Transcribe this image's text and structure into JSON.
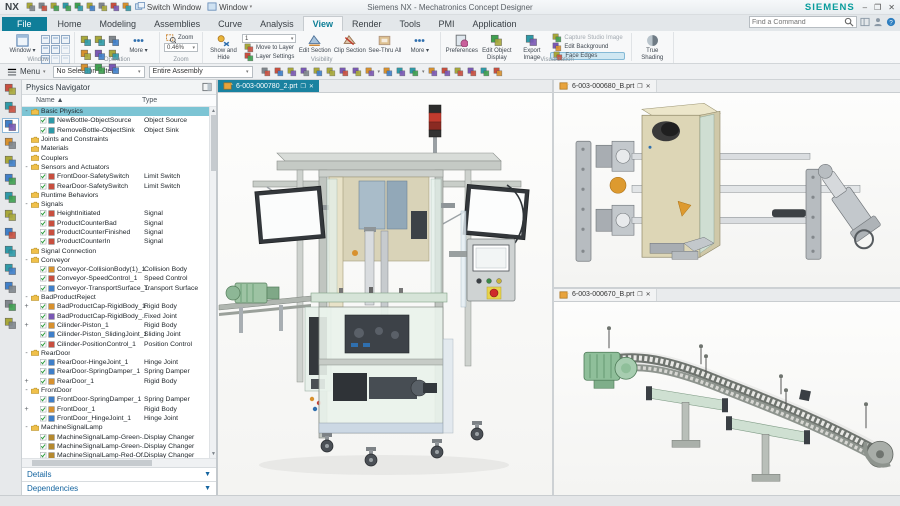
{
  "window": {
    "title": "Siemens NX - Mechatronics Concept Designer",
    "brand": "SIEMENS",
    "switch_window_label": "Switch Window",
    "window_menu_label": "Window",
    "quick_access_icons": [
      "save-icon",
      "undo-icon",
      "redo-icon",
      "cut-icon",
      "copy-icon",
      "paste-icon",
      "touch-mode-icon",
      "sketch-icon",
      "repeat-command-icon"
    ]
  },
  "search": {
    "placeholder": "Find a Command"
  },
  "ribbon": {
    "tabs": [
      {
        "label": "File",
        "kind": "file"
      },
      {
        "label": "Home"
      },
      {
        "label": "Modeling"
      },
      {
        "label": "Assemblies"
      },
      {
        "label": "Curve"
      },
      {
        "label": "Analysis"
      },
      {
        "label": "View",
        "active": true
      },
      {
        "label": "Render"
      },
      {
        "label": "Tools"
      },
      {
        "label": "PMI"
      },
      {
        "label": "Application"
      }
    ],
    "groups": {
      "window": {
        "label": "Window",
        "button": "Window"
      },
      "operation": {
        "label": "Operation",
        "more": "More"
      },
      "zoom": {
        "label": "Zoom",
        "button": "Zoom",
        "value": "0.46%"
      },
      "visibility": {
        "label": "Visibility",
        "show_hide": "Show and Hide",
        "layer_value": "1",
        "move_to_layer": "Move to Layer",
        "layer_settings": "Layer Settings",
        "edit_section": "Edit Section",
        "clip_section": "Clip Section",
        "see_thru": "See-Thru All",
        "more": "More"
      },
      "visualization": {
        "label": "Visualization",
        "preferences": "Preferences",
        "edit_object": "Edit Object Display",
        "export_image": "Export Image",
        "capture": "Capture Studio Image",
        "background": "Edit Background",
        "face_edges": "Face Edges",
        "true_shading": "True Shading"
      }
    }
  },
  "selection_bar": {
    "menu_label": "Menu",
    "filter_value": "No Selection Filter",
    "scope_value": "Entire Assembly",
    "icons": [
      "select-all-icon",
      "snap-point-icon",
      "end-point-icon",
      "mid-point-icon",
      "control-point-icon",
      "intersection-icon",
      "arc-center-icon",
      "quadrant-point-icon",
      "existing-point-icon",
      "point-on-curve-icon",
      "point-on-face-icon",
      "bounded-plane-icon",
      "shaded-icon",
      "wireframe-icon",
      "orient-view-icon",
      "fit-view-icon",
      "pan-icon",
      "rotate-icon"
    ]
  },
  "resource_bar": {
    "icons": [
      "roles-gear-icon",
      "assembly-navigator-icon",
      "physics-navigator-icon",
      "constraint-navigator-icon",
      "part-navigator-icon",
      "reuse-library-icon",
      "hd3d-tools-icon",
      "internet-explorer-icon",
      "history-icon",
      "process-studio-icon",
      "manufacturing-wizard-icon",
      "roles-icon",
      "system-scenes-icon",
      "touch-panel-icon"
    ],
    "active_index": 2
  },
  "navigator": {
    "title": "Physics Navigator",
    "columns": {
      "name": "Name",
      "type": "Type"
    },
    "details_label": "Details",
    "dependencies_label": "Dependencies",
    "items": [
      {
        "name": "Basic Physics",
        "kind": "folder",
        "expand": "-",
        "selected": true,
        "type": ""
      },
      {
        "name": "NewBottle-ObjectSource",
        "kind": "leaf",
        "type": "Object Source"
      },
      {
        "name": "RemoveBottle-ObjectSink",
        "kind": "leaf",
        "type": "Object Sink"
      },
      {
        "name": "Joints and Constraints",
        "kind": "folder",
        "expand": "",
        "type": ""
      },
      {
        "name": "Materials",
        "kind": "folder",
        "expand": "",
        "type": ""
      },
      {
        "name": "Couplers",
        "kind": "folder",
        "expand": "",
        "type": ""
      },
      {
        "name": "Sensors and Actuators",
        "kind": "folder",
        "expand": "-",
        "type": ""
      },
      {
        "name": "FrontDoor-SafetySwitch",
        "kind": "leaf",
        "type": "Limit Switch"
      },
      {
        "name": "RearDoor-SafetySwitch",
        "kind": "leaf",
        "type": "Limit Switch"
      },
      {
        "name": "Runtime Behaviors",
        "kind": "folder",
        "expand": "",
        "type": ""
      },
      {
        "name": "Signals",
        "kind": "folder",
        "expand": "-",
        "type": ""
      },
      {
        "name": "HeightInitiated",
        "kind": "leaf",
        "type": "Signal"
      },
      {
        "name": "ProductCounterBad",
        "kind": "leaf",
        "type": "Signal"
      },
      {
        "name": "ProductCounterFinished",
        "kind": "leaf",
        "type": "Signal"
      },
      {
        "name": "ProductCounterIn",
        "kind": "leaf",
        "type": "Signal"
      },
      {
        "name": "Signal Connection",
        "kind": "folder",
        "expand": "",
        "type": ""
      },
      {
        "name": "Conveyor",
        "kind": "folder",
        "expand": "-",
        "type": ""
      },
      {
        "name": "Conveyor-CollisionBody(1)_1",
        "kind": "leaf",
        "type": "Collision Body"
      },
      {
        "name": "Conveyor-SpeedControl_1",
        "kind": "leaf",
        "type": "Speed Control"
      },
      {
        "name": "Conveyor-TransportSurface_1",
        "kind": "leaf",
        "type": "Transport Surface"
      },
      {
        "name": "BadProductReject",
        "kind": "folder",
        "expand": "-",
        "type": ""
      },
      {
        "name": "BadProductCap-RigidBody_1",
        "kind": "leaf",
        "expand": "+",
        "type": "Rigid Body"
      },
      {
        "name": "BadProductCap-RigidBody_...",
        "kind": "leaf",
        "type": "Fixed Joint"
      },
      {
        "name": "Cilinder-Piston_1",
        "kind": "leaf",
        "expand": "+",
        "type": "Rigid Body"
      },
      {
        "name": "Cilinder-Piston_SlidingJoint_1",
        "kind": "leaf",
        "type": "Sliding Joint"
      },
      {
        "name": "Cilinder-PositionControl_1",
        "kind": "leaf",
        "type": "Position Control"
      },
      {
        "name": "RearDoor",
        "kind": "folder",
        "expand": "-",
        "type": ""
      },
      {
        "name": "RearDoor-HingeJoint_1",
        "kind": "leaf",
        "type": "Hinge Joint"
      },
      {
        "name": "RearDoor-SpringDamper_1",
        "kind": "leaf",
        "type": "Spring Damper"
      },
      {
        "name": "RearDoor_1",
        "kind": "leaf",
        "expand": "+",
        "type": "Rigid Body"
      },
      {
        "name": "FrontDoor",
        "kind": "folder",
        "expand": "-",
        "type": ""
      },
      {
        "name": "FrontDoor-SpringDamper_1",
        "kind": "leaf",
        "type": "Spring Damper"
      },
      {
        "name": "FrontDoor_1",
        "kind": "leaf",
        "expand": "+",
        "type": "Rigid Body"
      },
      {
        "name": "FrontDoor_HingeJoint_1",
        "kind": "leaf",
        "type": "Hinge Joint"
      },
      {
        "name": "MachineSignalLamp",
        "kind": "folder",
        "expand": "-",
        "type": ""
      },
      {
        "name": "MachineSignalLamp-Green-...",
        "kind": "leaf",
        "type": "Display Changer"
      },
      {
        "name": "MachineSignalLamp-Green-...",
        "kind": "leaf",
        "type": "Display Changer"
      },
      {
        "name": "MachineSignalLamp-Red-Of...",
        "kind": "leaf",
        "type": "Display Changer"
      }
    ]
  },
  "viewports": {
    "main": {
      "tab": "6-003-000780_2.prt"
    },
    "top_right": {
      "tab": "6-003-000680_B.prt"
    },
    "bottom_right": {
      "tab": "6-003-000670_B.prt"
    }
  },
  "colors": {
    "accent_teal": "#1a82a0",
    "brand_teal": "#089c9c",
    "selection": "#7cc4d4",
    "file_tab": "#0f7e99"
  }
}
